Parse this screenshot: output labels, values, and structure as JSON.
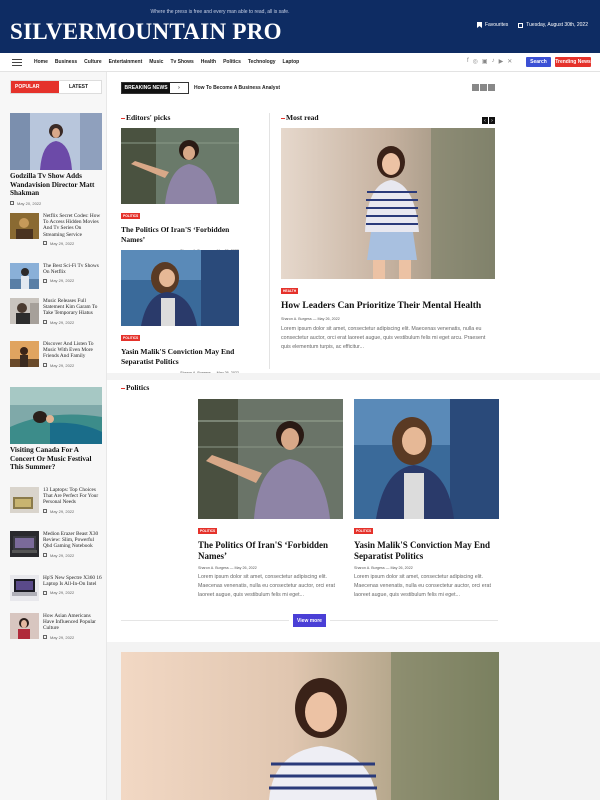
{
  "header": {
    "tagline": "Where the press is free and every man able to read, all is safe.",
    "logo": "SILVERMOUNTAIN PRO",
    "favourites": "Favourites",
    "date": "Tuesday, August 30th, 2022"
  },
  "nav": {
    "items": [
      "Home",
      "Business",
      "Culture",
      "Entertainment",
      "Music",
      "Tv Shows",
      "Health",
      "Politics",
      "Technology",
      "Laptop"
    ],
    "search_label": "Search",
    "trending_label": "Trending News"
  },
  "sidebar": {
    "tab_popular": "POPULAR",
    "tab_latest": "LATEST",
    "big_posts": [
      {
        "title": "Godzilla Tv Show Adds Wandavision Director Matt Shakman",
        "date": "May 20, 2022"
      },
      {
        "title": "Visiting Canada For A Concert Or Music Festival This Summer?",
        "date": ""
      }
    ],
    "small_posts": [
      {
        "title": "Netflix Secret Codes: How To Access Hidden Movies And Tv Series On Streaming Service",
        "date": "May 29, 2022"
      },
      {
        "title": "The Best Sci-Fi Tv Shows On Netflix",
        "date": "May 29, 2022"
      },
      {
        "title": "Music Releases Full Statement Kim Garam To Take Temporary Hiatus",
        "date": "May 29, 2022"
      },
      {
        "title": "Discover And Listen To Music With Even More Friends And Family",
        "date": "May 29, 2022"
      },
      {
        "title": "13 Laptops: Top Choices That Are Perfect For Your Personal Needs",
        "date": "May 29, 2022"
      },
      {
        "title": "Medion Erazer Beast X30 Review: Slim, Powerful Qhd Gaming Notebook",
        "date": "May 29, 2022"
      },
      {
        "title": "Hp'S New Spectre X360 16 Laptop Is All-In-On Intel",
        "date": "May 29, 2022"
      },
      {
        "title": "How Asian Americans Have Influenced Popular Culture",
        "date": "May 29, 2022"
      }
    ]
  },
  "breaking": {
    "label": "BREAKING NEWS",
    "headline": "How To Become A Business Analyst"
  },
  "editors": {
    "heading": "Editors' picks",
    "posts": [
      {
        "category": "POLITICS",
        "title": "The Politics Of Iran'S ‘Forbidden Names’",
        "meta": "Sharon A. Burgess  —  May 26, 2022"
      },
      {
        "category": "POLITICS",
        "title": "Yasin Malik'S Conviction May End Separatist Politics",
        "meta": "Sharon A. Burgess  —  May 26, 2022"
      }
    ]
  },
  "most_read": {
    "heading": "Most read",
    "category": "HEALTH",
    "title": "How Leaders Can Prioritize Their Mental Health",
    "meta": "Sharon A. Burgess  —  May 26, 2022",
    "excerpt": "Lorem ipsum dolor sit amet, consectetur adipiscing elit. Maecenas venenatis, nulla eu consectetur auctor, orci erat laoreet augue, quis vestibulum felis mi eget arcu. Praesent quis elementum turpis, ac efficitur..."
  },
  "politics": {
    "heading": "Politics",
    "posts": [
      {
        "category": "POLITICS",
        "title": "The Politics Of Iran'S ‘Forbidden Names’",
        "meta": "Sharon A. Burgess  —  May 26, 2022",
        "excerpt": "Lorem ipsum dolor sit amet, consectetur adipiscing elit. Maecenas venenatis, nulla eu consectetur auctor, orci erat laoreet augue, quis vestibulum felis mi eget..."
      },
      {
        "category": "POLITICS",
        "title": "Yasin Malik'S Conviction May End Separatist Politics",
        "meta": "Sharon A. Burgess  —  May 26, 2022",
        "excerpt": "Lorem ipsum dolor sit amet, consectetur adipiscing elit. Maecenas venenatis, nulla eu consectetur auctor, orci erat laoreet augue, quis vestibulum felis mi eget..."
      }
    ],
    "view_more": "View more"
  },
  "colors": {
    "header_bg": "#0e2c63",
    "accent_red": "#e5322b",
    "button_blue": "#3b50d4",
    "view_more": "#4a3fd6"
  }
}
